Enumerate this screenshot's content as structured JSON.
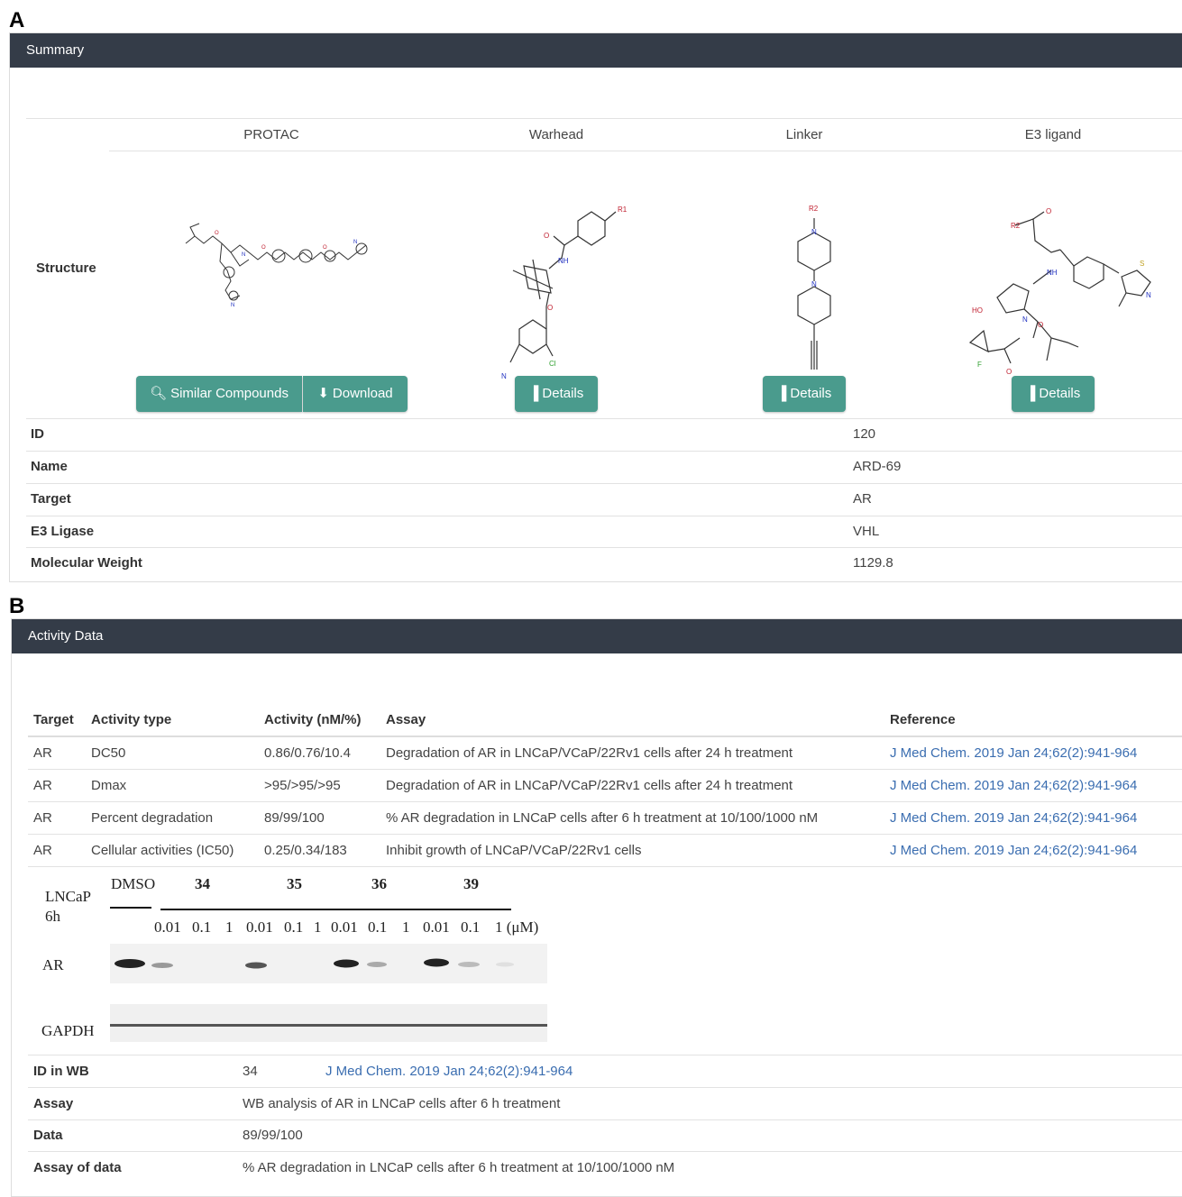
{
  "panel_a": {
    "letter": "A",
    "header": "Summary",
    "columns": [
      "PROTAC",
      "Warhead",
      "Linker",
      "E3 ligand"
    ],
    "structure_label": "Structure",
    "buttons": {
      "similar": "Similar Compounds",
      "download": "Download",
      "details": "Details"
    },
    "molecule_labels": {
      "r1": "R1",
      "r2": "R2",
      "nh": "NH",
      "h": "H",
      "n": "N",
      "o": "O",
      "s": "S",
      "f": "F",
      "cl": "Cl",
      "ho": "HO"
    },
    "properties": [
      {
        "label": "ID",
        "value": "120"
      },
      {
        "label": "Name",
        "value": "ARD-69"
      },
      {
        "label": "Target",
        "value": "AR"
      },
      {
        "label": "E3 Ligase",
        "value": "VHL"
      },
      {
        "label": "Molecular Weight",
        "value": "1129.8"
      }
    ]
  },
  "panel_b": {
    "letter": "B",
    "header": "Activity Data",
    "table": {
      "headers": [
        "Target",
        "Activity type",
        "Activity (nM/%)",
        "Assay",
        "Reference"
      ],
      "rows": [
        [
          "AR",
          "DC50",
          "0.86/0.76/10.4",
          "Degradation of AR in LNCaP/VCaP/22Rv1 cells after 24 h treatment",
          "J Med Chem. 2019 Jan 24;62(2):941-964"
        ],
        [
          "AR",
          "Dmax",
          ">95/>95/>95",
          "Degradation of AR in LNCaP/VCaP/22Rv1 cells after 24 h treatment",
          "J Med Chem. 2019 Jan 24;62(2):941-964"
        ],
        [
          "AR",
          "Percent degradation",
          "89/99/100",
          "% AR degradation in LNCaP cells after 6 h treatment at 10/100/1000 nM",
          "J Med Chem. 2019 Jan 24;62(2):941-964"
        ],
        [
          "AR",
          "Cellular activities (IC50)",
          "0.25/0.34/183",
          "Inhibit growth of LNCaP/VCaP/22Rv1 cells",
          "J Med Chem. 2019 Jan 24;62(2):941-964"
        ]
      ]
    },
    "western_blot": {
      "cell_line": "LNCaP",
      "time": "6h",
      "groups": [
        "DMSO",
        "34",
        "35",
        "36",
        "39"
      ],
      "doses": [
        "0.01",
        "0.1",
        "1",
        "0.01",
        "0.1",
        "1",
        "0.01",
        "0.1",
        "1",
        "0.01",
        "0.1",
        "1 (μM)"
      ],
      "rows": [
        "AR",
        "GAPDH"
      ]
    },
    "wb_info": {
      "id_label": "ID in WB",
      "id_value": "34",
      "id_reference": "J Med Chem. 2019 Jan 24;62(2):941-964",
      "assay_label": "Assay",
      "assay_value": "WB analysis of AR in LNCaP cells after 6 h treatment",
      "data_label": "Data",
      "data_value": "89/99/100",
      "assay_data_label": "Assay of data",
      "assay_data_value": "% AR degradation in LNCaP cells after 6 h treatment at 10/100/1000 nM"
    }
  }
}
